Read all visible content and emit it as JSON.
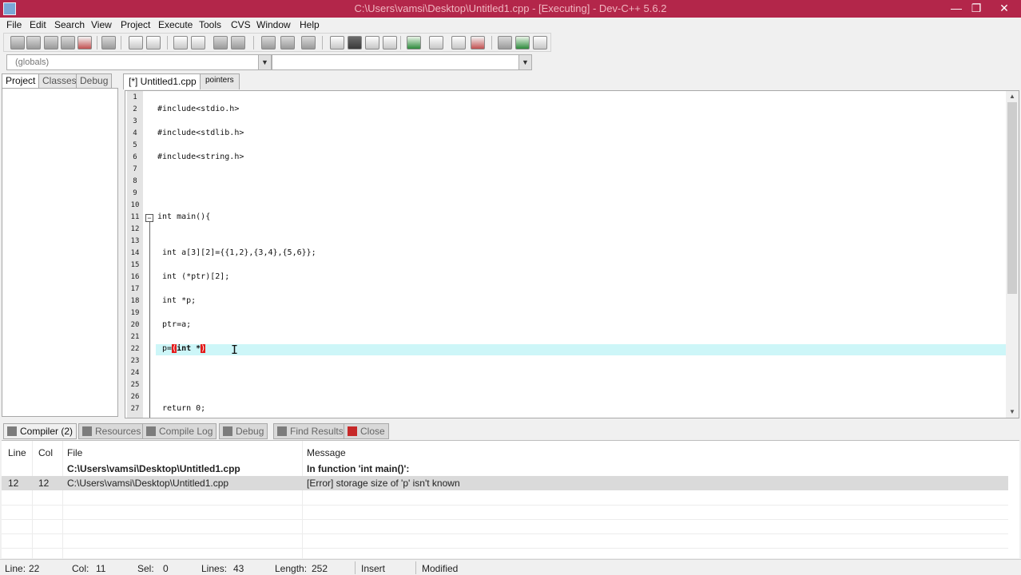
{
  "window": {
    "title": "C:\\Users\\vamsi\\Desktop\\Untitled1.cpp - [Executing] - Dev-C++ 5.6.2",
    "minimize": "—",
    "maximize": "❐",
    "close": "✕"
  },
  "menu": [
    "File",
    "Edit",
    "Search",
    "View",
    "Project",
    "Execute",
    "Tools",
    "CVS",
    "Window",
    "Help"
  ],
  "combo": {
    "left_value": "(globals)",
    "right_value": ""
  },
  "left_tabs": [
    "Project",
    "Classes",
    "Debug"
  ],
  "editor_tabs": [
    "[*] Untitled1.cpp",
    "pointers"
  ],
  "code_lines": [
    {
      "n": "1",
      "text": ""
    },
    {
      "n": "2",
      "text": "#include<stdio.h>",
      "cls": "pp"
    },
    {
      "n": "3",
      "text": ""
    },
    {
      "n": "4",
      "text": "#include<stdlib.h>",
      "cls": "pp"
    },
    {
      "n": "5",
      "text": ""
    },
    {
      "n": "6",
      "text": "#include<string.h>",
      "cls": "pp"
    },
    {
      "n": "7",
      "text": ""
    },
    {
      "n": "8",
      "text": ""
    },
    {
      "n": "9",
      "text": ""
    },
    {
      "n": "10",
      "text": ""
    },
    {
      "n": "11",
      "text": "int main(){"
    },
    {
      "n": "12",
      "text": ""
    },
    {
      "n": "13",
      "text": ""
    },
    {
      "n": "14",
      "text": " int a[3][2]={{1,2},{3,4},{5,6}};"
    },
    {
      "n": "15",
      "text": ""
    },
    {
      "n": "16",
      "text": " int (*ptr)[2];"
    },
    {
      "n": "17",
      "text": ""
    },
    {
      "n": "18",
      "text": " int *p;"
    },
    {
      "n": "19",
      "text": ""
    },
    {
      "n": "20",
      "text": " ptr=a;"
    },
    {
      "n": "21",
      "text": ""
    },
    {
      "n": "22",
      "text": ""
    },
    {
      "n": "23",
      "text": ""
    },
    {
      "n": "24",
      "text": ""
    },
    {
      "n": "25",
      "text": ""
    },
    {
      "n": "26",
      "text": ""
    },
    {
      "n": "27",
      "text": " return 0;"
    }
  ],
  "current_line": {
    "prefix": " p=",
    "open_paren": "(",
    "middle": "int *",
    "close_paren": ")"
  },
  "bottom_tabs": [
    "Compiler (2)",
    "Resources",
    "Compile Log",
    "Debug",
    "Find Results",
    "Close"
  ],
  "messages": {
    "headers": {
      "line": "Line",
      "col": "Col",
      "file": "File",
      "message": "Message"
    },
    "rows": [
      {
        "line": "",
        "col": "",
        "file": "C:\\Users\\vamsi\\Desktop\\Untitled1.cpp",
        "message": "In function 'int main()':"
      },
      {
        "line": "12",
        "col": "12",
        "file": "C:\\Users\\vamsi\\Desktop\\Untitled1.cpp",
        "message": "[Error] storage size of 'p' isn't known"
      }
    ]
  },
  "status": {
    "line_label": "Line:",
    "line_value": "22",
    "col_label": "Col:",
    "col_value": "11",
    "sel_label": "Sel:",
    "sel_value": "0",
    "lines_label": "Lines:",
    "lines_value": "43",
    "length_label": "Length:",
    "length_value": "252",
    "mode": "Insert",
    "state": "Modified"
  }
}
